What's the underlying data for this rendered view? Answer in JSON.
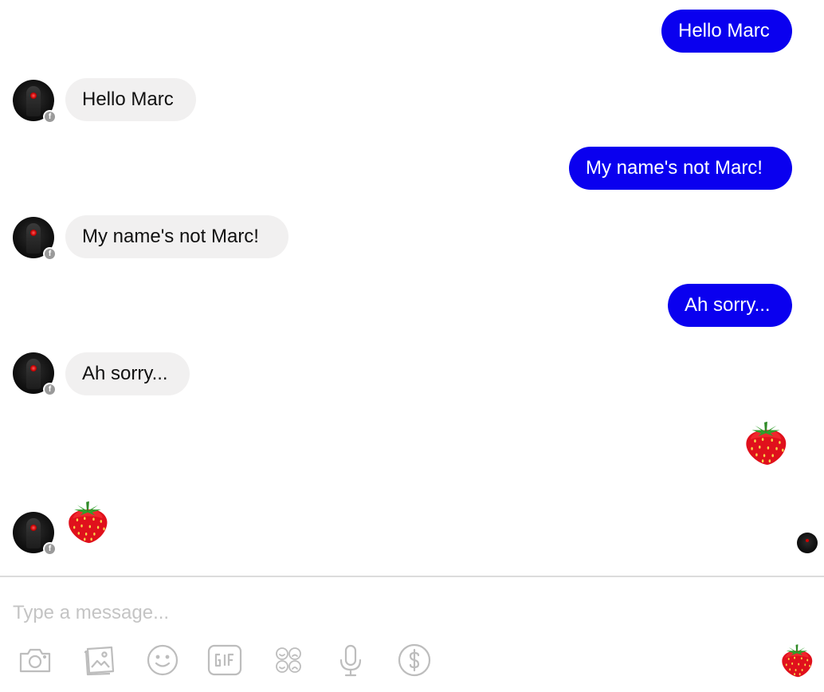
{
  "messages": [
    {
      "direction": "outgoing",
      "text": "Hello Marc"
    },
    {
      "direction": "incoming",
      "text": "Hello Marc"
    },
    {
      "direction": "outgoing",
      "text": "My name's not Marc!"
    },
    {
      "direction": "incoming",
      "text": "My name's not Marc!"
    },
    {
      "direction": "outgoing",
      "text": "Ah sorry..."
    },
    {
      "direction": "incoming",
      "text": "Ah sorry..."
    },
    {
      "direction": "outgoing",
      "emoji": "strawberry"
    },
    {
      "direction": "incoming",
      "emoji": "strawberry"
    }
  ],
  "composer": {
    "placeholder": "Type a message...",
    "value": ""
  },
  "toolbar": {
    "icons": [
      "camera-icon",
      "image-icon",
      "emoji-icon",
      "gif-icon",
      "stickers-icon",
      "microphone-icon",
      "payment-icon"
    ],
    "send_emoji": "strawberry"
  },
  "colors": {
    "outgoing_bubble": "#0a00ef",
    "incoming_bubble": "#f1f0f0",
    "icon_gray": "#bdbdbd"
  }
}
